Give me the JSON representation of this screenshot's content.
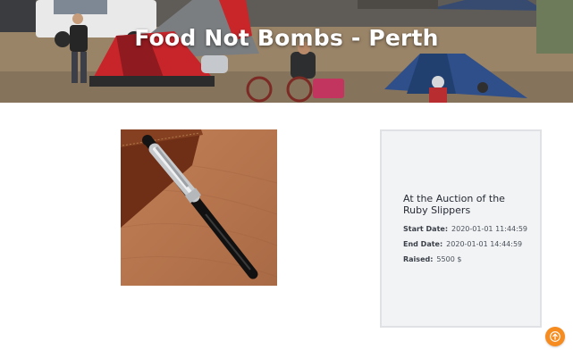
{
  "header": {
    "title": "Food Not Bombs - Perth"
  },
  "product": {
    "image_subject": "black fountain pen on wooden surface"
  },
  "auction": {
    "title": "At the Auction of the Ruby Slippers",
    "start_label": "Start Date:",
    "start_value": "2020-01-01 11:44:59",
    "end_label": "End Date:",
    "end_value": "2020-01-01 14:44:59",
    "raised_label": "Raised:",
    "raised_value": "5500 $"
  },
  "scroll_top": {
    "icon": "arrow-up-icon",
    "color": "#f68b1f"
  }
}
